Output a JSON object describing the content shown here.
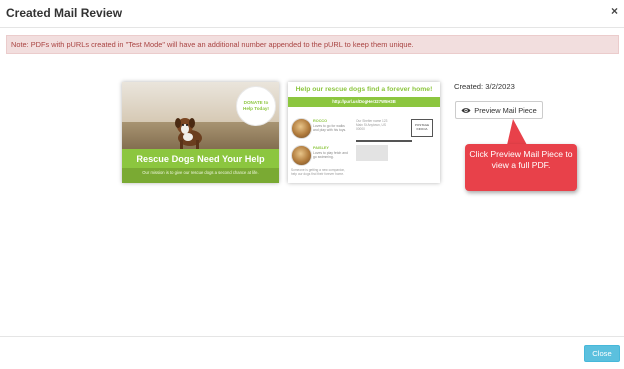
{
  "modal": {
    "title": "Created Mail Review",
    "close_symbol": "×"
  },
  "notice": {
    "text": "Note: PDFs with pURLs created in \"Test Mode\" will have an additional number appended to the pURL to keep them unique."
  },
  "front": {
    "donate_label": "DONATE to Help Today!",
    "headline": "Rescue Dogs Need Your Help",
    "subline": "Our mission is to give our rescue dogs a second chance at life."
  },
  "back": {
    "headline": "Help our rescue dogs find a forever home!",
    "url": "http://purl.us/DogHer327W5H3B",
    "pet1_name": "ROCCO",
    "pet1_text": "Loves to go for walks and play with his toys.",
    "pet2_name": "PAISLEY",
    "pet2_text": "Loves to play fetch and go swimming.",
    "return_text": "Our Shelter name 123 Main St Anytown, US 00000",
    "stamp": "POSTAGE INDICIA",
    "footer_text": "Someone is getting a new companion, help our dogs find their forever home."
  },
  "created_label": "Created: 3/2/2023",
  "preview_button": "Preview Mail Piece",
  "callout": {
    "text": "Click Preview Mail Piece to view a full PDF."
  },
  "footer": {
    "close_button": "Close"
  },
  "colors": {
    "brand_green": "#8cc63f",
    "callout_red": "#e8414a",
    "close_button": "#5bc0de",
    "notice_bg": "#f2dede",
    "notice_text": "#a94442"
  }
}
